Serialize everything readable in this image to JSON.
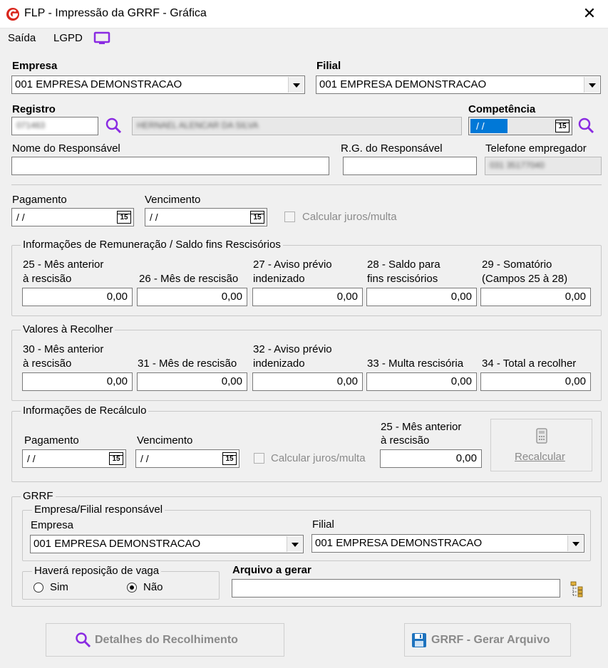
{
  "window": {
    "title": "FLP - Impressão da GRRF - Gráfica",
    "close": "✕"
  },
  "menu": {
    "saida": "Saída",
    "lgpd": "LGPD"
  },
  "empresa": {
    "label": "Empresa",
    "value": "001 EMPRESA DEMONSTRACAO"
  },
  "filial": {
    "label": "Filial",
    "value": "001 EMPRESA DEMONSTRACAO"
  },
  "registro": {
    "label": "Registro",
    "code": "071463",
    "name": "HERNAEL ALENCAR DA SILVA"
  },
  "competencia": {
    "label": "Competência",
    "value": "/ /"
  },
  "responsavel": {
    "nome_label": "Nome do Responsável",
    "rg_label": "R.G. do Responsável",
    "telefone_label": "Telefone empregador",
    "telefone_value": "031 35177040"
  },
  "pagamento": {
    "label": "Pagamento",
    "value": "/ /"
  },
  "vencimento": {
    "label": "Vencimento",
    "value": "/ /"
  },
  "calcular_juros": "Calcular juros/multa",
  "calendar_icon_text": "15",
  "remuneracao": {
    "title": "Informações de Remuneração / Saldo fins Rescisórios",
    "fields": [
      {
        "l1": "25 - Mês anterior",
        "l2": "à rescisão",
        "value": "0,00"
      },
      {
        "l1": "",
        "l2": "26 - Mês de rescisão",
        "value": "0,00"
      },
      {
        "l1": "27 - Aviso prévio",
        "l2": "indenizado",
        "value": "0,00"
      },
      {
        "l1": "28 - Saldo para",
        "l2": "fins rescisórios",
        "value": "0,00"
      },
      {
        "l1": "29 - Somatório",
        "l2": "(Campos 25 à 28)",
        "value": "0,00"
      }
    ]
  },
  "recolher": {
    "title": "Valores à Recolher",
    "fields": [
      {
        "l1": "30 - Mês anterior",
        "l2": "à rescisão",
        "value": "0,00"
      },
      {
        "l1": "",
        "l2": "31 - Mês de rescisão",
        "value": "0,00"
      },
      {
        "l1": "32 - Aviso prévio",
        "l2": "indenizado",
        "value": "0,00"
      },
      {
        "l1": "",
        "l2": "33 - Multa rescisória",
        "value": "0,00"
      },
      {
        "l1": "",
        "l2": "34 - Total a recolher",
        "value": "0,00"
      }
    ]
  },
  "recalculo": {
    "title": "Informações de Recálculo",
    "pagamento_label": "Pagamento",
    "pagamento_value": "/ /",
    "vencimento_label": "Vencimento",
    "vencimento_value": "/ /",
    "calcular_juros": "Calcular juros/multa",
    "mes_l1": "25 - Mês anterior",
    "mes_l2": "à rescisão",
    "mes_value": "0,00",
    "recalcular_button": "Recalcular"
  },
  "grrf": {
    "title": "GRRF",
    "responsavel_title": "Empresa/Filial responsável",
    "empresa_label": "Empresa",
    "empresa_value": "001 EMPRESA DEMONSTRACAO",
    "filial_label": "Filial",
    "filial_value": "001 EMPRESA DEMONSTRACAO",
    "reposicao_title": "Haverá reposição de vaga",
    "sim": "Sim",
    "nao": "Não",
    "arquivo_label": "Arquivo a gerar"
  },
  "buttons": {
    "detalhes": "Detalhes do Recolhimento",
    "gerar": "GRRF - Gerar Arquivo"
  },
  "colors": {
    "accent_purple": "#8a2be2",
    "logo_red": "#d9261c",
    "save_blue": "#1e73be"
  }
}
